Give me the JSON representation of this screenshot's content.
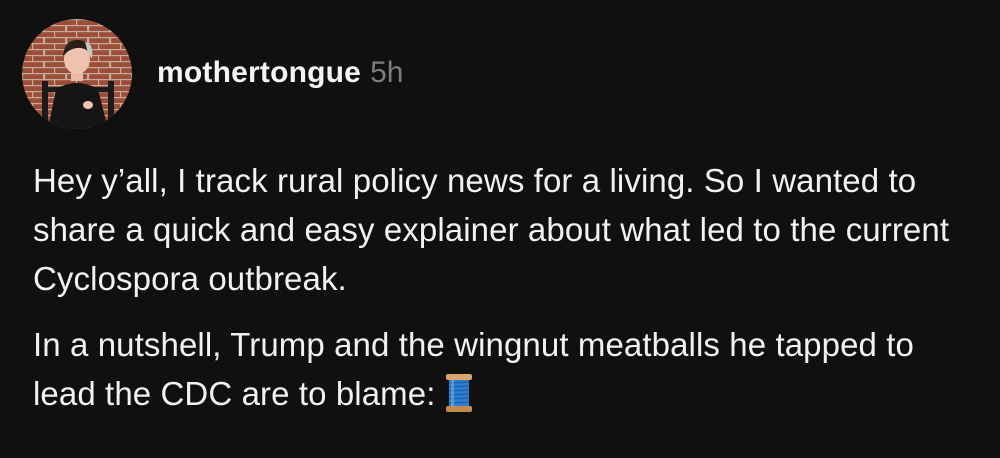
{
  "post": {
    "author": {
      "username": "mothertongue",
      "timestamp": "5h",
      "avatar_icon": "profile-photo"
    },
    "paragraphs": [
      "Hey y’all, I track rural policy news for a living. So I wanted to share a quick and easy explainer about what led to the current Cyclospora outbreak.",
      "In a nutshell, Trump and the wingnut meatballs he tapped to lead the CDC are to blame:"
    ],
    "emoji": {
      "name": "spool-of-thread-icon",
      "color": "#2f7fd0"
    }
  }
}
